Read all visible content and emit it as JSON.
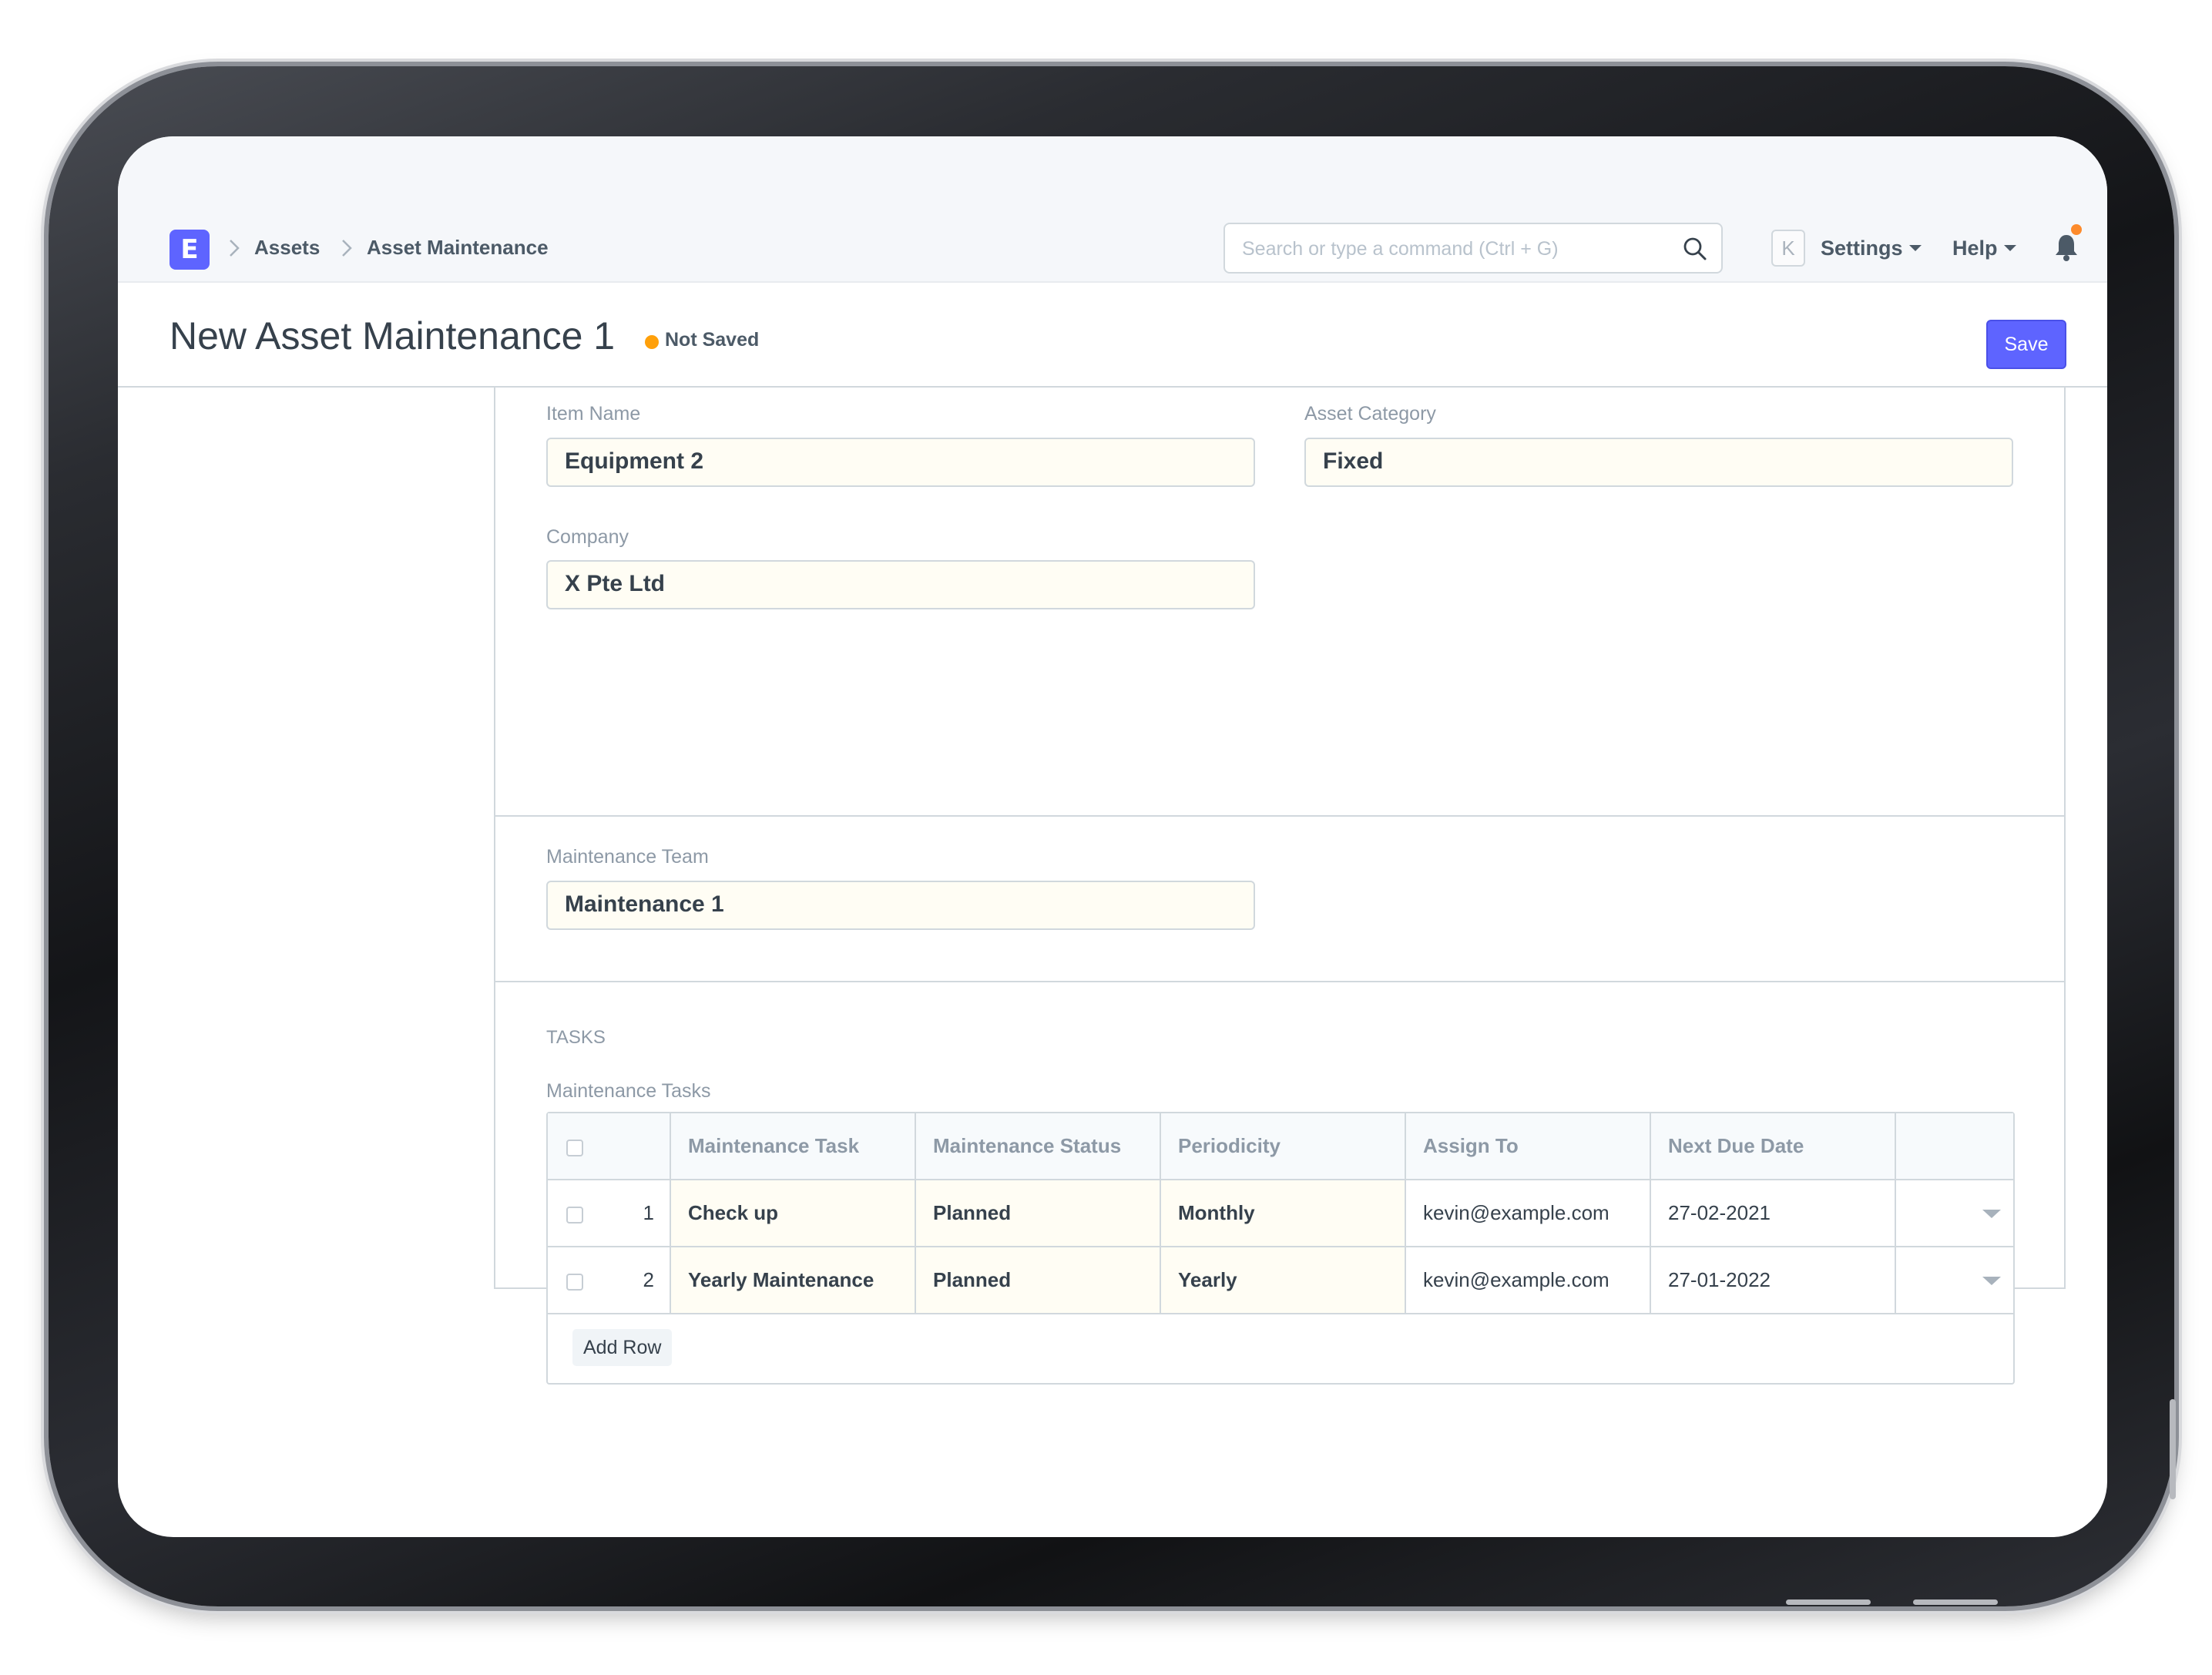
{
  "navbar": {
    "logo_letter": "E",
    "breadcrumbs": [
      "Assets",
      "Asset Maintenance"
    ],
    "search_placeholder": "Search or type a command (Ctrl + G)",
    "avatar_letter": "K",
    "settings_label": "Settings",
    "help_label": "Help"
  },
  "page": {
    "title": "New Asset Maintenance 1",
    "status": "Not Saved",
    "save_label": "Save"
  },
  "form": {
    "item_name": {
      "label": "Item Name",
      "value": "Equipment 2"
    },
    "asset_category": {
      "label": "Asset Category",
      "value": "Fixed"
    },
    "company": {
      "label": "Company",
      "value": "X Pte Ltd"
    },
    "maintenance_team": {
      "label": "Maintenance Team",
      "value": "Maintenance 1"
    },
    "tasks_section_label": "TASKS",
    "tasks_field_label": "Maintenance Tasks"
  },
  "tasks_table": {
    "columns": [
      "Maintenance Task",
      "Maintenance Status",
      "Periodicity",
      "Assign To",
      "Next Due Date"
    ],
    "rows": [
      {
        "idx": "1",
        "task": "Check up",
        "status": "Planned",
        "periodicity": "Monthly",
        "assign_to": "kevin@example.com",
        "next_due_date": "27-02-2021"
      },
      {
        "idx": "2",
        "task": "Yearly Maintenance",
        "status": "Planned",
        "periodicity": "Yearly",
        "assign_to": "kevin@example.com",
        "next_due_date": "27-01-2022"
      }
    ],
    "add_row_label": "Add Row"
  },
  "colors": {
    "accent": "#5e64ff",
    "status_dot": "#ffa00a",
    "notification_dot": "#fd8b2c"
  },
  "icons": {
    "breadcrumb_separator": "chevron-right-icon",
    "search": "search-icon",
    "notifications": "bell-icon",
    "row_menu": "caret-down-icon"
  }
}
